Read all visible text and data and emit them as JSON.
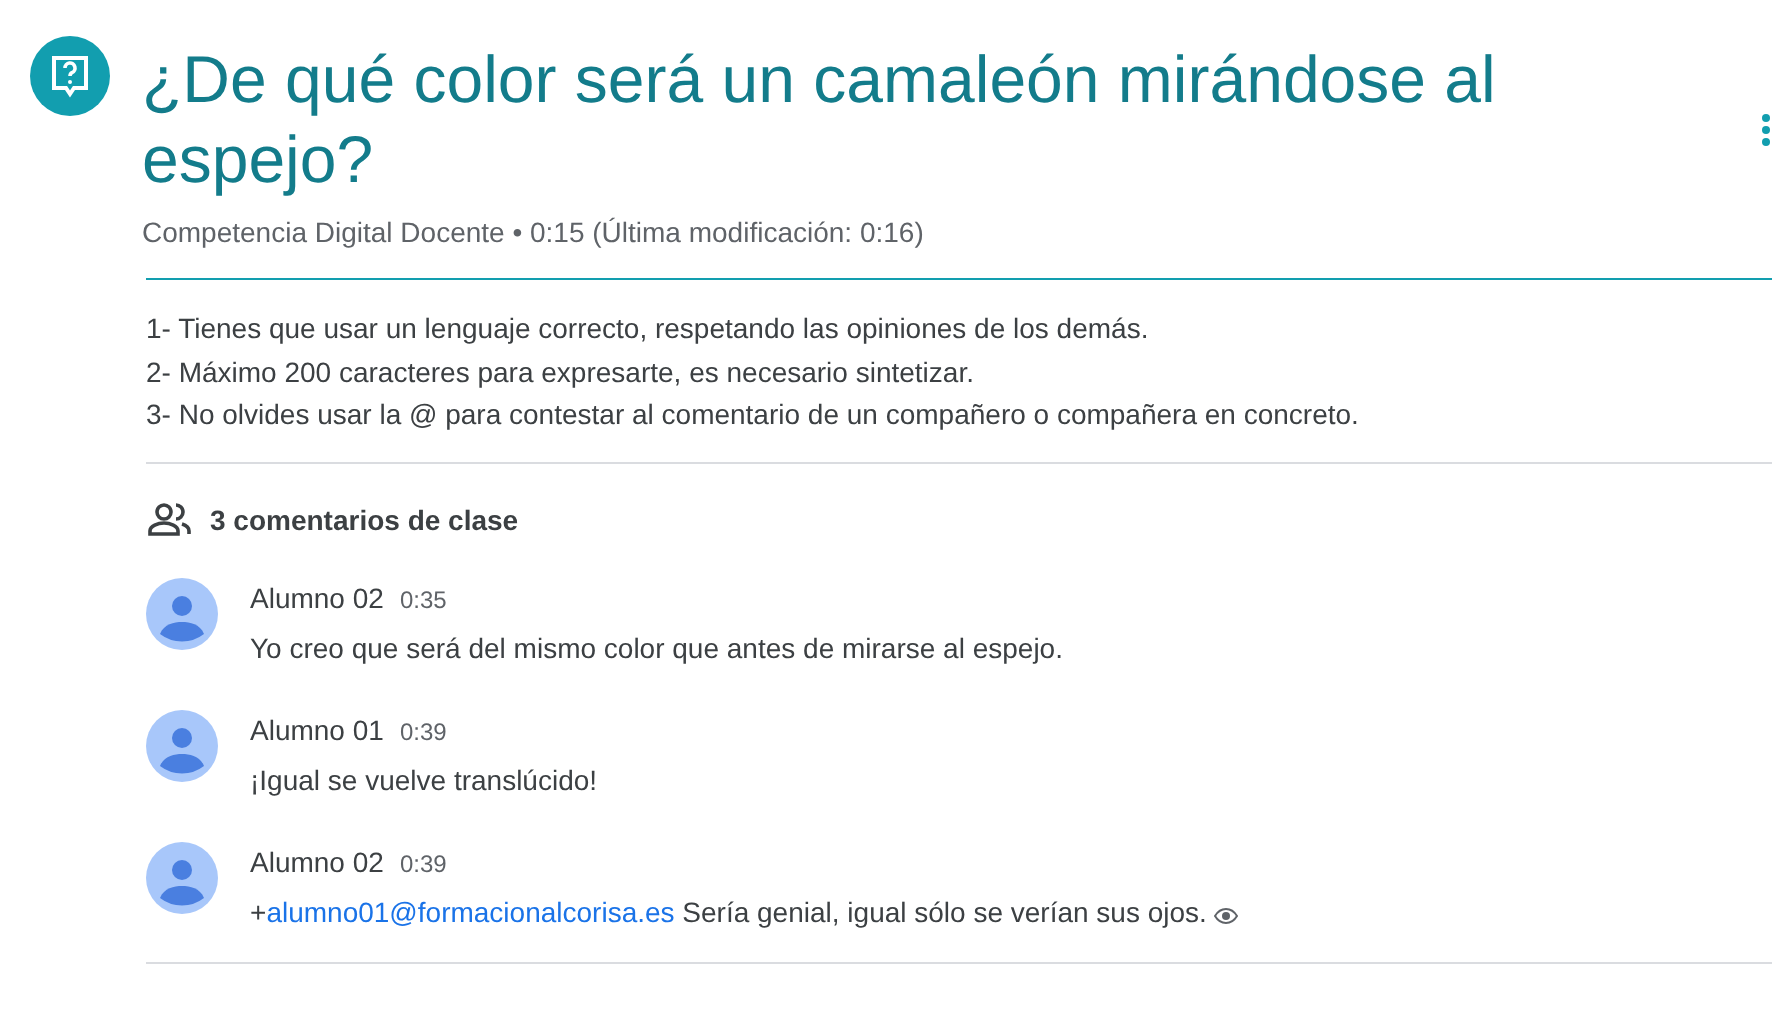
{
  "header": {
    "title": "¿De qué color será un camaleón mirándose al espejo?",
    "subtitle": "Competencia Digital Docente • 0:15 (Última modificación: 0:16)"
  },
  "instructions": [
    "1- Tienes que usar un lenguaje correcto, respetando las opiniones de los demás.",
    "2- Máximo 200 caracteres para expresarte, es necesario sintetizar.",
    "3- No olvides usar la @ para contestar al comentario de un compañero o compañera en concreto."
  ],
  "comments_heading": "3 comentarios de clase",
  "comments": [
    {
      "author": "Alumno 02",
      "time": "0:35",
      "text": "Yo creo que será del mismo color que antes de mirarse al espejo."
    },
    {
      "author": "Alumno 01",
      "time": "0:39",
      "text": "¡Igual se vuelve translúcido!"
    },
    {
      "author": "Alumno 02",
      "time": "0:39",
      "prefix": "+",
      "mention": "alumno01@formacionalcorisa.es",
      "text": "Sería genial, igual sólo se verían sus ojos.",
      "eye_icon": true
    }
  ]
}
